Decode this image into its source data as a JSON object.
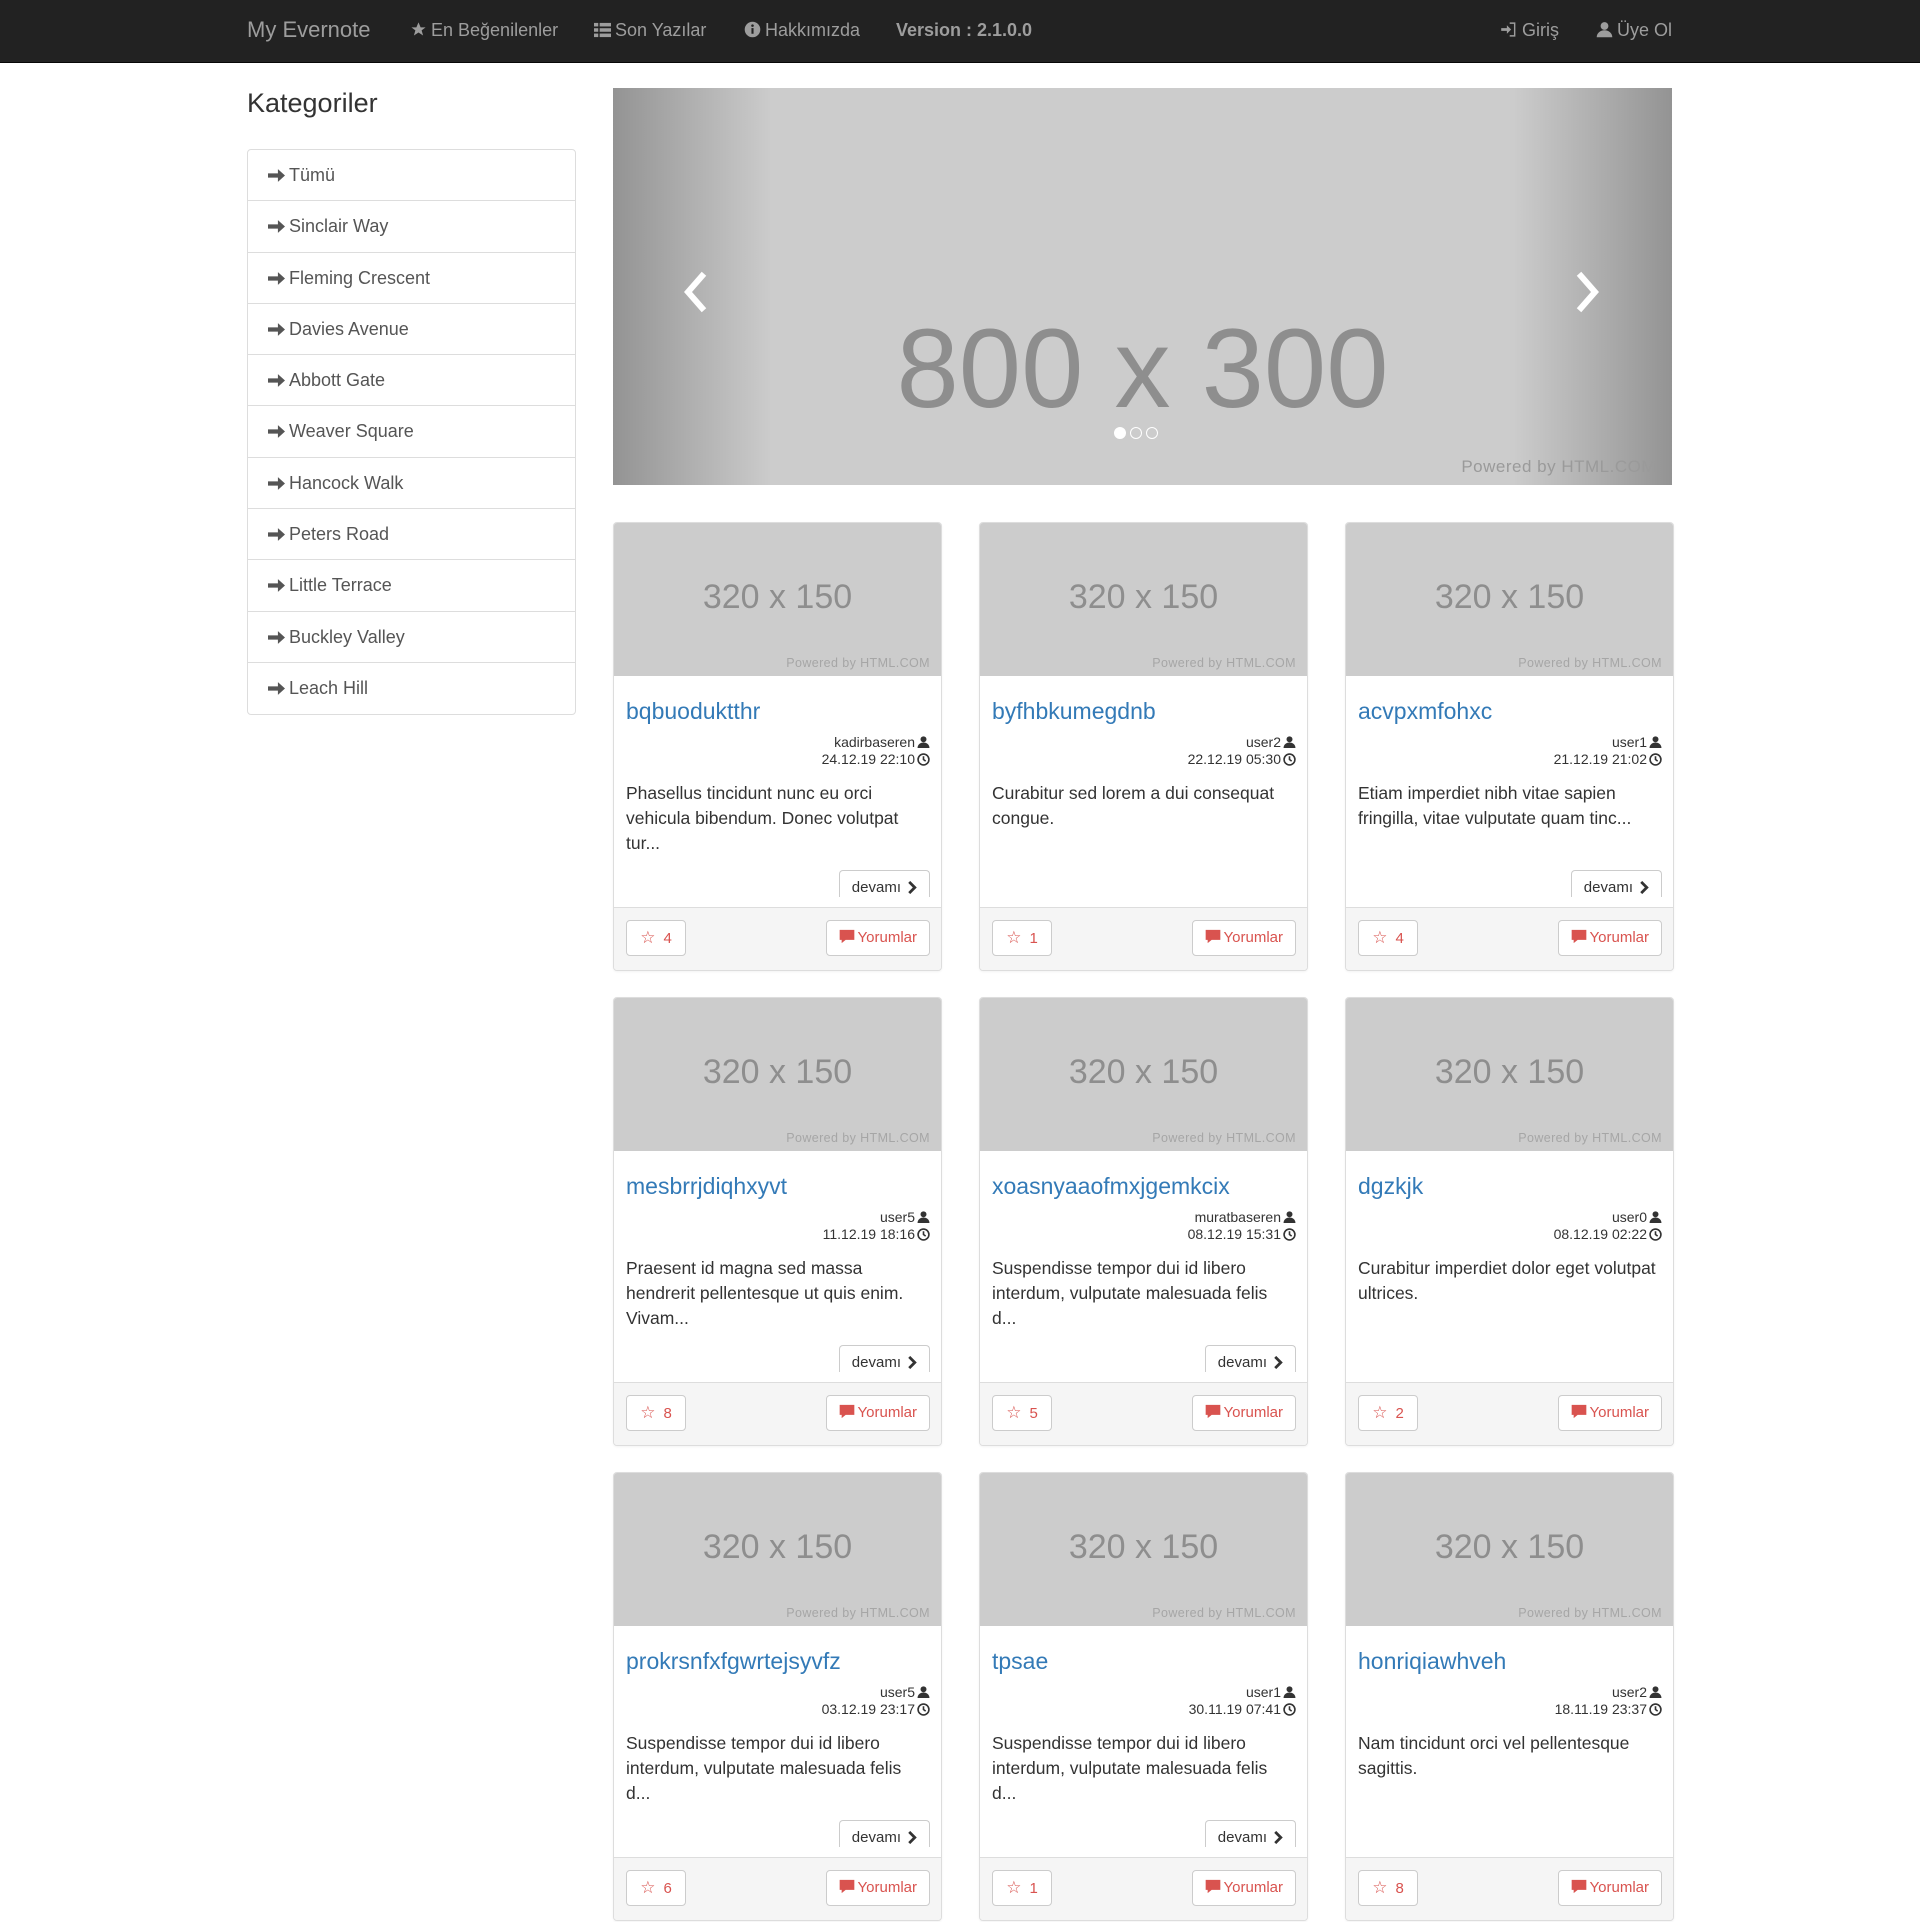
{
  "navbar": {
    "brand": "My Evernote",
    "items": [
      {
        "label": "En Beğenilenler",
        "icon": "star-icon"
      },
      {
        "label": "Son Yazılar",
        "icon": "list-icon"
      },
      {
        "label": "Hakkımızda",
        "icon": "info-icon"
      }
    ],
    "version": "Version : 2.1.0.0",
    "login": "Giriş",
    "register": "Üye Ol"
  },
  "sidebar": {
    "title": "Kategoriler",
    "items": [
      "Tümü",
      "Sinclair Way",
      "Fleming Crescent",
      "Davies Avenue",
      "Abbott Gate",
      "Weaver Square",
      "Hancock Walk",
      "Peters Road",
      "Little Terrace",
      "Buckley Valley",
      "Leach Hill"
    ]
  },
  "carousel": {
    "placeholder": "800 x 300",
    "powered": "Powered by HTML.COM",
    "slides": 3,
    "active_slide": 1
  },
  "cards": [
    {
      "title": "bqbuoduktthr",
      "author": "kadirbaseren",
      "date": "24.12.19 22:10",
      "text": "Phasellus tincidunt nunc eu orci vehicula bibendum. Donec volutpat tur...",
      "more": "devamı",
      "likes": "4",
      "comments": "Yorumlar",
      "image": "320 x 150",
      "powered": "Powered by HTML.COM"
    },
    {
      "title": "byfhbkumegdnb",
      "author": "user2",
      "date": "22.12.19 05:30",
      "text": "Curabitur sed lorem a dui consequat congue.",
      "more": "",
      "likes": "1",
      "comments": "Yorumlar",
      "image": "320 x 150",
      "powered": "Powered by HTML.COM"
    },
    {
      "title": "acvpxmfohxc",
      "author": "user1",
      "date": "21.12.19 21:02",
      "text": "Etiam imperdiet nibh vitae sapien fringilla, vitae vulputate quam tinc...",
      "more": "devamı",
      "likes": "4",
      "comments": "Yorumlar",
      "image": "320 x 150",
      "powered": "Powered by HTML.COM"
    },
    {
      "title": "mesbrrjdiqhxyvt",
      "author": "user5",
      "date": "11.12.19 18:16",
      "text": "Praesent id magna sed massa hendrerit pellentesque ut quis enim. Vivam...",
      "more": "devamı",
      "likes": "8",
      "comments": "Yorumlar",
      "image": "320 x 150",
      "powered": "Powered by HTML.COM"
    },
    {
      "title": "xoasnyaaofmxjgemkcix",
      "author": "muratbaseren",
      "date": "08.12.19 15:31",
      "text": "Suspendisse tempor dui id libero interdum, vulputate malesuada felis d...",
      "more": "devamı",
      "likes": "5",
      "comments": "Yorumlar",
      "image": "320 x 150",
      "powered": "Powered by HTML.COM"
    },
    {
      "title": "dgzkjk",
      "author": "user0",
      "date": "08.12.19 02:22",
      "text": "Curabitur imperdiet dolor eget volutpat ultrices.",
      "more": "",
      "likes": "2",
      "comments": "Yorumlar",
      "image": "320 x 150",
      "powered": "Powered by HTML.COM"
    },
    {
      "title": "prokrsnfxfgwrtejsyvfz",
      "author": "user5",
      "date": "03.12.19 23:17",
      "text": "Suspendisse tempor dui id libero interdum, vulputate malesuada felis d...",
      "more": "devamı",
      "likes": "6",
      "comments": "Yorumlar",
      "image": "320 x 150",
      "powered": "Powered by HTML.COM"
    },
    {
      "title": "tpsae",
      "author": "user1",
      "date": "30.11.19 07:41",
      "text": "Suspendisse tempor dui id libero interdum, vulputate malesuada felis d...",
      "more": "devamı",
      "likes": "1",
      "comments": "Yorumlar",
      "image": "320 x 150",
      "powered": "Powered by HTML.COM"
    },
    {
      "title": "honriqiawhveh",
      "author": "user2",
      "date": "18.11.19 23:37",
      "text": "Nam tincidunt orci vel pellentesque sagittis.",
      "more": "",
      "likes": "8",
      "comments": "Yorumlar",
      "image": "320 x 150",
      "powered": "Powered by HTML.COM"
    }
  ],
  "colors": {
    "navbar_bg": "#222222",
    "navbar_text": "#9d9d9d",
    "link": "#337ab7",
    "danger": "#d9534f",
    "placeholder_bg": "#cccccc"
  }
}
